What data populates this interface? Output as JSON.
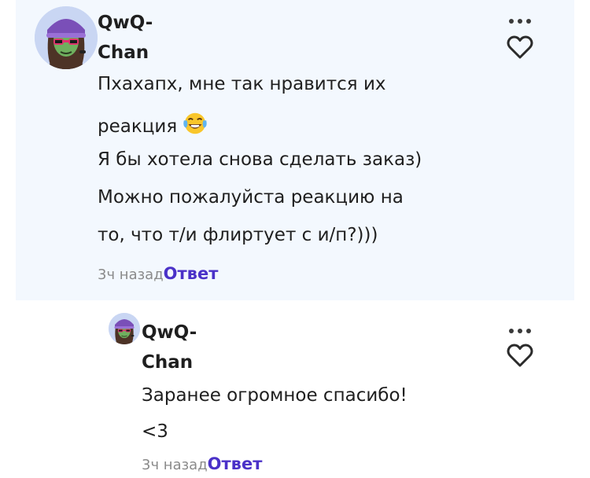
{
  "comment": {
    "author": {
      "name_line1": "QwQ-",
      "name_line2": "Chan"
    },
    "lines": [
      "Пхахапх, мне так нравится их",
      "реакция",
      "Я бы хотела снова сделать заказ)",
      "Можно пожалуйста реакцию на",
      "то, что т/и флиртует с и/п?)))"
    ],
    "emoji": "joy-tears-emoji",
    "time": "3ч назад",
    "reply_label": "Ответ",
    "icons": [
      "more-dots-icon",
      "heart-outline-icon"
    ]
  },
  "reply": {
    "author": {
      "name_line1": "QwQ-",
      "name_line2": "Chan"
    },
    "lines": [
      "Заранее огромное спасибо!",
      "<3"
    ],
    "time": "3ч назад",
    "reply_label": "Ответ",
    "icons": [
      "more-dots-icon",
      "heart-outline-icon"
    ]
  },
  "colors": {
    "comment_background": "#f3f8fe",
    "reply_link": "#4a31c8",
    "muted_text": "#8a8a8a",
    "body_text": "#1f1f1f",
    "avatar_hat": "#7a4fb8",
    "avatar_glasses": "#e0326e"
  }
}
